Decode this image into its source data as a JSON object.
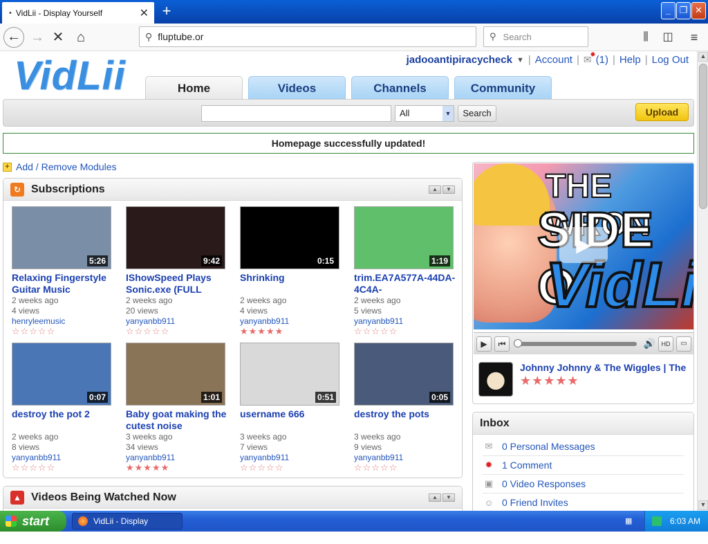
{
  "browser": {
    "tab_title": "VidLii - Display Yourself",
    "url": "fluptube.or",
    "search_placeholder": "Search"
  },
  "header": {
    "logo": "VidLii",
    "username": "jadooantipiracycheck",
    "account": "Account",
    "mail_count": "(1)",
    "help": "Help",
    "logout": "Log Out"
  },
  "nav": {
    "tabs": [
      "Home",
      "Videos",
      "Channels",
      "Community"
    ]
  },
  "search": {
    "category": "All",
    "button": "Search",
    "upload": "Upload"
  },
  "notice": "Homepage successfully updated!",
  "modules_link": "Add / Remove Modules",
  "subscriptions": {
    "title": "Subscriptions",
    "videos": [
      {
        "title": "Relaxing Fingerstyle Guitar Music",
        "duration": "5:26",
        "age": "2 weeks ago",
        "views": "4 views",
        "user": "henryleemusic",
        "rating": 0,
        "color": "#7a8ea8"
      },
      {
        "title": "IShowSpeed Plays Sonic.exe (FULL",
        "duration": "9:42",
        "age": "2 weeks ago",
        "views": "20 views",
        "user": "yanyanbb911",
        "rating": 0,
        "color": "#2a1a1a"
      },
      {
        "title": "Shrinking",
        "duration": "0:15",
        "age": "2 weeks ago",
        "views": "4 views",
        "user": "yanyanbb911",
        "rating": 5,
        "color": "#000000"
      },
      {
        "title": "trim.EA7A577A-44DA-4C4A-",
        "duration": "1:19",
        "age": "2 weeks ago",
        "views": "5 views",
        "user": "yanyanbb911",
        "rating": 0,
        "color": "#5fbf6a"
      },
      {
        "title": "destroy the pot 2",
        "duration": "0:07",
        "age": "2 weeks ago",
        "views": "8 views",
        "user": "yanyanbb911",
        "rating": 0,
        "color": "#4a76b6"
      },
      {
        "title": "Baby goat making the cutest noise",
        "duration": "1:01",
        "age": "3 weeks ago",
        "views": "34 views",
        "user": "yanyanbb911",
        "rating": 5,
        "color": "#8a7458"
      },
      {
        "title": "username 666",
        "duration": "0:51",
        "age": "3 weeks ago",
        "views": "7 views",
        "user": "yanyanbb911",
        "rating": 0,
        "color": "#d9d9d9"
      },
      {
        "title": "destroy the pots",
        "duration": "0:05",
        "age": "3 weeks ago",
        "views": "9 views",
        "user": "yanyanbb911",
        "rating": 0,
        "color": "#4a5a7a"
      }
    ]
  },
  "watching_title": "Videos Being Watched Now",
  "player": {
    "line1": "THE WRON",
    "line2": "SIDE O",
    "line3": "VidLii",
    "now_playing": "Johnny Johnny & The Wiggles | The",
    "rating": 5
  },
  "inbox": {
    "title": "Inbox",
    "items": [
      "0 Personal Messages",
      "1 Comment",
      "0 Video Responses",
      "0 Friend Invites"
    ]
  },
  "taskbar": {
    "start": "start",
    "task": "VidLii - Display Yourse...",
    "time": "6:03 AM"
  }
}
